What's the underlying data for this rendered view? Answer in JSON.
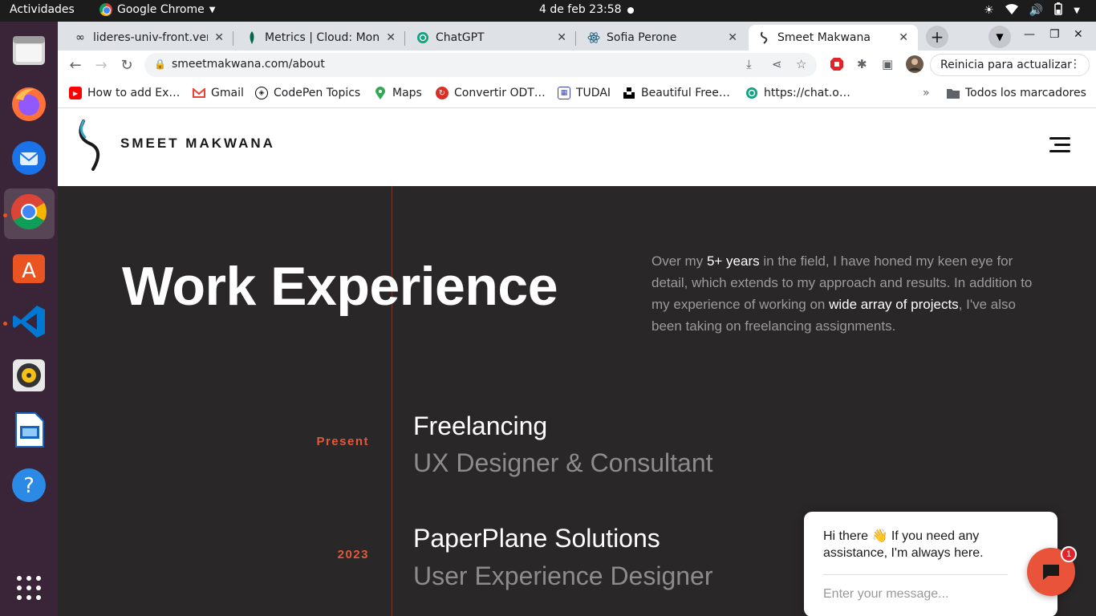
{
  "os": {
    "activities": "Actividades",
    "app_name": "Google Chrome",
    "clock": "4 de feb  23:58",
    "dock": [
      "files-icon",
      "firefox-icon",
      "thunderbird-icon",
      "chrome-icon",
      "software-center-icon",
      "vscode-icon",
      "rhythmbox-icon",
      "libreoffice-impress-icon",
      "help-icon",
      "app-grid-icon"
    ]
  },
  "browser": {
    "tabs": [
      {
        "title": "lideres-univ-front.vercel",
        "icon": "link-icon"
      },
      {
        "title": "Metrics | Cloud: MongoDB",
        "icon": "mongodb-icon"
      },
      {
        "title": "ChatGPT",
        "icon": "chatgpt-icon"
      },
      {
        "title": "Sofia Perone",
        "icon": "react-icon"
      },
      {
        "title": "Smeet Makwana",
        "icon": "smeet-logo-icon"
      }
    ],
    "url": "smeetmakwana.com/about",
    "update_label": "Reinicia para actualizar",
    "bookmarks": [
      {
        "label": "How to add Ex…",
        "icon": "youtube-icon",
        "color": "#ff0000"
      },
      {
        "label": "Gmail",
        "icon": "gmail-icon",
        "color": "#ea4335"
      },
      {
        "label": "CodePen Topics",
        "icon": "codepen-icon",
        "color": "#000000"
      },
      {
        "label": "Maps",
        "icon": "maps-icon",
        "color": "#34a853"
      },
      {
        "label": "Convertir ODT…",
        "icon": "convert-icon",
        "color": "#d93025"
      },
      {
        "label": "TUDAI",
        "icon": "calendar-icon",
        "color": "#3949ab"
      },
      {
        "label": "Beautiful Free…",
        "icon": "unsplash-icon",
        "color": "#000000"
      },
      {
        "label": "https://chat.o…",
        "icon": "chatgpt-icon",
        "color": "#10a37f"
      }
    ],
    "all_bookmarks": "Todos los marcadores"
  },
  "site": {
    "brand": "SMEET MAKWANA",
    "hero_title": "Work Experience",
    "intro": {
      "p1": "Over my ",
      "h1": "5+ years",
      "p2": " in the field, I have honed my keen eye for detail, which extends to my approach and results. In addition to my experience of working on ",
      "h2": "wide array of projects",
      "p3": ", I've also been taking on freelancing assignments."
    },
    "experience": [
      {
        "year": "Present",
        "company": "Freelancing",
        "role": "UX Designer & Consultant"
      },
      {
        "year": "2023",
        "company": "PaperPlane Solutions",
        "role": "User Experience Designer"
      }
    ],
    "chat": {
      "greeting": "Hi there 👋 If you need any assistance, I'm always here.",
      "placeholder": "Enter your message...",
      "badge": "1"
    }
  },
  "colors": {
    "accent": "#e25a3a",
    "dark_bg": "#292728",
    "chat_button": "#e8533a"
  }
}
